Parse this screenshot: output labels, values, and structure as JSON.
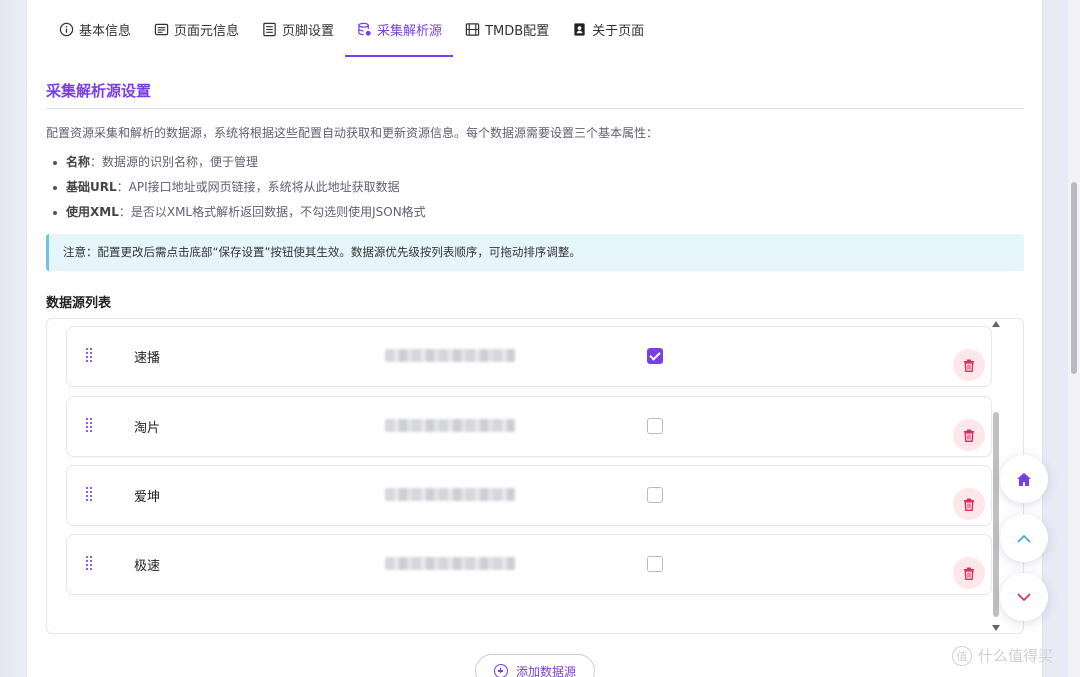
{
  "tabs": [
    {
      "label": "基本信息",
      "icon": "info-icon",
      "active": false
    },
    {
      "label": "页面元信息",
      "icon": "meta-icon",
      "active": false
    },
    {
      "label": "页脚设置",
      "icon": "footer-icon",
      "active": false
    },
    {
      "label": "采集解析源",
      "icon": "database-icon",
      "active": true
    },
    {
      "label": "TMDB配置",
      "icon": "film-icon",
      "active": false
    },
    {
      "label": "关于页面",
      "icon": "portrait-icon",
      "active": false
    }
  ],
  "section": {
    "title": "采集解析源设置",
    "description": "配置资源采集和解析的数据源，系统将根据这些配置自动获取和更新资源信息。每个数据源需要设置三个基本属性：",
    "bullets": [
      {
        "term": "名称",
        "text": "：数据源的识别名称，便于管理"
      },
      {
        "term": "基础URL",
        "text": "：API接口地址或网页链接，系统将从此地址获取数据"
      },
      {
        "term": "使用XML",
        "text": "：是否以XML格式解析返回数据，不勾选则使用JSON格式"
      }
    ],
    "notice": "注意：配置更改后需点击底部“保存设置”按钮使其生效。数据源优先级按列表顺序，可拖动排序调整。"
  },
  "list": {
    "title": "数据源列表",
    "rows": [
      {
        "name": "速播",
        "use_xml": true
      },
      {
        "name": "淘片",
        "use_xml": false
      },
      {
        "name": "爱坤",
        "use_xml": false
      },
      {
        "name": "极速",
        "use_xml": false
      }
    ],
    "add_label": "添加数据源"
  },
  "fabs": [
    "home-icon",
    "chevron-up-icon",
    "chevron-down-icon"
  ],
  "watermark": "什么值得买",
  "colors": {
    "accent": "#7a3fe4",
    "danger": "#e0245e",
    "notice_border": "#6bc6e3"
  }
}
